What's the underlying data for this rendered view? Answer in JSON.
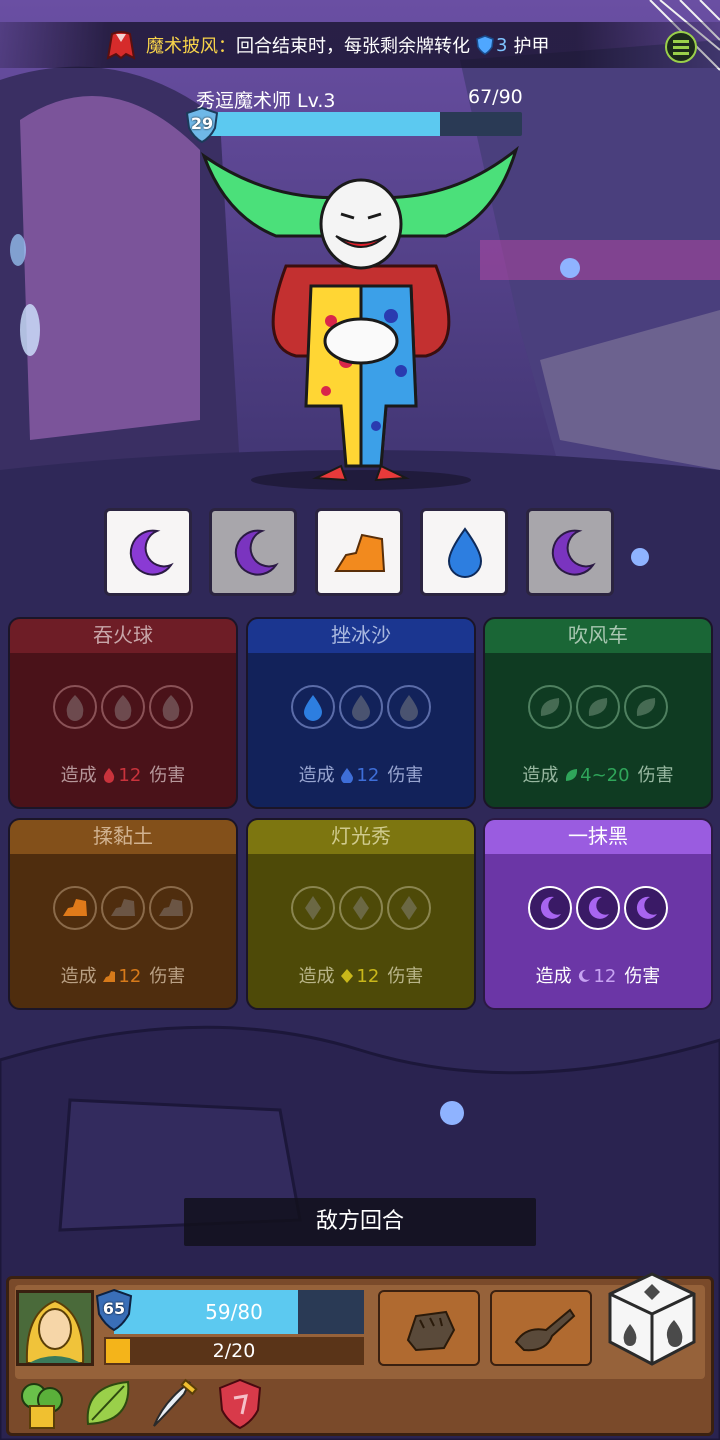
{
  "relic_banner": {
    "name": "魔术披风",
    "separator": "：",
    "text": "回合结束时，每张剩余牌转化",
    "armor_value": "3",
    "armor_label": "护甲",
    "icons": [
      "cape-icon",
      "shield-icon",
      "menu-icon"
    ]
  },
  "enemy": {
    "name": "秀逗魔术师 Lv.3",
    "hp_text": "67/90",
    "hp_current": 67,
    "hp_max": 90,
    "armor": "29",
    "colors": {
      "hp_bar": "#5cc9f0"
    }
  },
  "element_cards": [
    {
      "element": "dark",
      "icon": "moon-icon",
      "state": "selected"
    },
    {
      "element": "dark",
      "icon": "moon-icon",
      "state": "used"
    },
    {
      "element": "clay",
      "icon": "clay-icon",
      "state": "selected"
    },
    {
      "element": "water",
      "icon": "water-drop-icon",
      "state": "selected"
    },
    {
      "element": "dark",
      "icon": "moon-icon",
      "state": "used"
    }
  ],
  "skills": [
    {
      "id": "fire",
      "name": "吞火球",
      "prefix": "造成",
      "value": "12",
      "suffix": "伤害",
      "slot_icon": "fire-icon"
    },
    {
      "id": "ice",
      "name": "挫冰沙",
      "prefix": "造成",
      "value": "12",
      "suffix": "伤害",
      "slot_icon": "water-drop-icon"
    },
    {
      "id": "wind",
      "name": "吹风车",
      "prefix": "造成",
      "value": "4~20",
      "suffix": "伤害",
      "slot_icon": "leaf-icon"
    },
    {
      "id": "clay",
      "name": "揉黏土",
      "prefix": "造成",
      "value": "12",
      "suffix": "伤害",
      "slot_icon": "clay-icon"
    },
    {
      "id": "light",
      "name": "灯光秀",
      "prefix": "造成",
      "value": "12",
      "suffix": "伤害",
      "slot_icon": "diamond-icon"
    },
    {
      "id": "dark",
      "name": "一抹黑",
      "prefix": "造成",
      "value": "12",
      "suffix": "伤害",
      "slot_icon": "moon-icon",
      "active": true
    }
  ],
  "turn_label": "敌方回合",
  "player": {
    "armor": "65",
    "hp_text": "59/80",
    "hp_current": 59,
    "hp_max": 80,
    "energy_text": "2/20",
    "energy_current": 2,
    "energy_max": 20
  },
  "actions": [
    {
      "icon": "fist-icon"
    },
    {
      "icon": "tool-icon"
    }
  ],
  "dice": {
    "icon": "dice-icon"
  },
  "items": [
    "herb-pot-icon",
    "leaf-icon",
    "dagger-icon",
    "gem-shield-icon"
  ],
  "colors": {
    "accent": "#f7d34a",
    "armor": "#7fc4ff",
    "dark_element": "#8a3ad4"
  }
}
